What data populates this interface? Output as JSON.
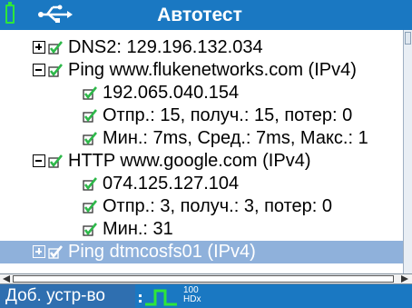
{
  "title": "Автотест",
  "icons": {
    "battery": "battery-icon",
    "usb": "usb-icon",
    "expand": "expand-icon",
    "collapse": "collapse-icon",
    "check": "check-icon",
    "link": "link-status-icon"
  },
  "colors": {
    "bar": "#1a78c2",
    "selection": "#8fb1db",
    "check_green": "#2eb84a",
    "link_green": "#2ee63a"
  },
  "tree": [
    {
      "text": "DNS2: 129.196.132.034",
      "expander": "expand",
      "level": 1,
      "selected": false
    },
    {
      "text": "Ping www.flukenetworks.com (IPv4)",
      "expander": "collapse",
      "level": 1,
      "selected": false
    },
    {
      "text": "192.065.040.154",
      "expander": null,
      "level": 2,
      "selected": false
    },
    {
      "text": "Отпр.: 15, получ.: 15, потер: 0",
      "expander": null,
      "level": 2,
      "selected": false
    },
    {
      "text": "Мин.: 7ms, Сред.: 7ms, Макс.: 1",
      "expander": null,
      "level": 2,
      "selected": false
    },
    {
      "text": "HTTP www.google.com (IPv4)",
      "expander": "collapse",
      "level": 1,
      "selected": false
    },
    {
      "text": "074.125.127.104",
      "expander": null,
      "level": 2,
      "selected": false
    },
    {
      "text": "Отпр.: 3, получ.: 3, потер: 0",
      "expander": null,
      "level": 2,
      "selected": false
    },
    {
      "text": "Мин.: 31",
      "expander": null,
      "level": 2,
      "selected": false
    },
    {
      "text": "Ping dtmcosfs01 (IPv4)",
      "expander": "expand",
      "level": 1,
      "selected": true
    }
  ],
  "softkey": "Доб. устр-во",
  "link_speed": {
    "value": "100",
    "duplex": "HDx"
  }
}
